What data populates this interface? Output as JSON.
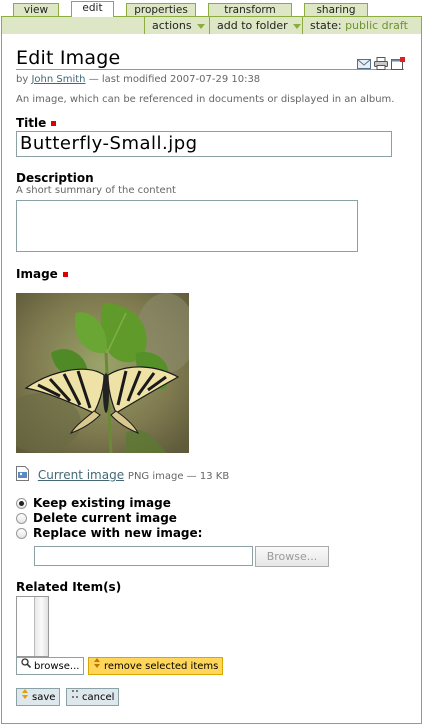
{
  "tabs": [
    {
      "label": "view"
    },
    {
      "label": "edit"
    },
    {
      "label": "properties"
    },
    {
      "label": "transform"
    },
    {
      "label": "sharing"
    }
  ],
  "actionbar": {
    "actions_label": "actions",
    "add_to_folder_label": "add to folder",
    "state_label": "state:",
    "state_value": "public draft"
  },
  "page": {
    "title": "Edit Image",
    "byline_prefix": "by",
    "author": "John Smith",
    "byline_suffix": "— last modified 2007-07-29 10:38",
    "description": "An image, which can be referenced in documents or displayed in an album."
  },
  "form": {
    "title_label": "Title",
    "title_value": "Butterfly-Small.jpg",
    "description_label": "Description",
    "description_help": "A short summary of the content",
    "description_value": "",
    "image_label": "Image",
    "current_image_link": "Current image",
    "current_image_meta": "PNG image — 13 KB",
    "radio_options": [
      {
        "label": "Keep existing image",
        "checked": true
      },
      {
        "label": "Delete current image",
        "checked": false
      },
      {
        "label": "Replace with new image:",
        "checked": false
      }
    ],
    "browse_label": "Browse...",
    "related_label": "Related Item(s)",
    "related_browse_label": "browse...",
    "remove_selected_label": "remove selected items",
    "save_label": "save",
    "cancel_label": "cancel"
  },
  "icons": [
    "send-to-icon",
    "print-icon",
    "full-screen-icon",
    "image-file-icon",
    "magnifier-icon",
    "remove-arrows-icon",
    "save-arrows-icon",
    "cancel-x-icon"
  ],
  "colors": {
    "accent": "#8cac3f",
    "tab_bg": "#dee7c5",
    "link": "#436976",
    "required": "#dd0000",
    "highlight_button": "#ffd55a"
  }
}
